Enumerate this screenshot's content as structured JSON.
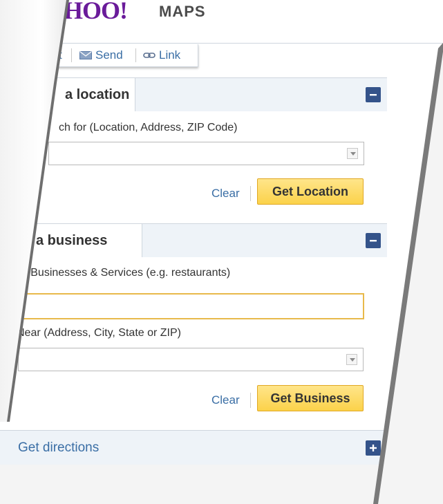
{
  "brand": {
    "logo_text": "HOO!",
    "product": "MAPS",
    "logo_color": "#6a1b9a"
  },
  "toolbar": {
    "print_partial": "t",
    "send_label": "Send",
    "link_label": "Link"
  },
  "location": {
    "title": "a location",
    "search_label": "ch for (Location, Address, ZIP Code)",
    "input_value": "",
    "clear_label": "Clear",
    "submit_label": "Get Location"
  },
  "business": {
    "title": "nd a business",
    "find_label": "nd Businesses & Services (e.g. restaurants)",
    "find_value": "",
    "near_label": "Near (Address, City, State or ZIP)",
    "near_value": "",
    "clear_label": "Clear",
    "submit_label": "Get Business"
  },
  "directions": {
    "label": "Get directions"
  },
  "colors": {
    "accent_button": "#fbd24a",
    "header_bg": "#eef3f8",
    "toggle_bg": "#34538a",
    "link": "#3a6ea5"
  },
  "icons": {
    "collapse": "minus-icon",
    "expand": "plus-icon",
    "send": "envelope-icon",
    "link": "chain-link-icon"
  }
}
